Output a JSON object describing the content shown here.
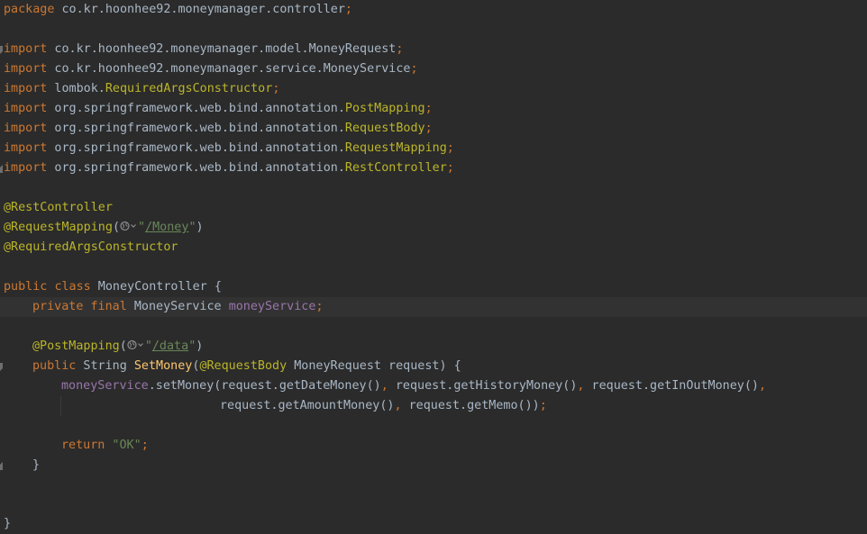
{
  "editor": {
    "lines": {
      "l1": {
        "kw": "package",
        "rest": " co.kr.hoonhee92.moneymanager.controller",
        "semi": ";"
      },
      "l3": {
        "kw": "import",
        "rest": " co.kr.hoonhee92.moneymanager.model.MoneyRequest",
        "semi": ";"
      },
      "l4": {
        "kw": "import",
        "rest": " co.kr.hoonhee92.moneymanager.service.MoneyService",
        "semi": ";"
      },
      "l5": {
        "kw": "import",
        "pkg": " lombok.",
        "cls": "RequiredArgsConstructor",
        "semi": ";"
      },
      "l6": {
        "kw": "import",
        "pkg": " org.springframework.web.bind.annotation.",
        "cls": "PostMapping",
        "semi": ";"
      },
      "l7": {
        "kw": "import",
        "pkg": " org.springframework.web.bind.annotation.",
        "cls": "RequestBody",
        "semi": ";"
      },
      "l8": {
        "kw": "import",
        "pkg": " org.springframework.web.bind.annotation.",
        "cls": "RequestMapping",
        "semi": ";"
      },
      "l9": {
        "kw": "import",
        "pkg": " org.springframework.web.bind.annotation.",
        "cls": "RestController",
        "semi": ";"
      },
      "l11": {
        "ann": "@RestController"
      },
      "l12": {
        "ann": "@RequestMapping",
        "open": "(",
        "q1": "\"",
        "url": "/Money",
        "q2": "\"",
        "close": ")"
      },
      "l13": {
        "ann": "@RequiredArgsConstructor"
      },
      "l15": {
        "kw1": "public",
        "kw2": "class",
        "name": " MoneyController ",
        "brace": "{"
      },
      "l16": {
        "kw1": "private",
        "kw2": "final",
        "type": " MoneyService ",
        "field": "moneyService",
        "semi": ";"
      },
      "l18": {
        "ann": "@PostMapping",
        "open": "(",
        "q1": "\"",
        "url": "/data",
        "q2": "\"",
        "close": ")"
      },
      "l19": {
        "kw": "public",
        "type": " String ",
        "fn": "SetMoney",
        "open": "(",
        "ann": "@RequestBody",
        "params": " MoneyRequest request) {"
      },
      "l20": {
        "field": "moneyService",
        "call": ".setMoney(request.getDateMoney()",
        "c1": ",",
        "p2": " request.getHistoryMoney()",
        "c2": ",",
        "p3": " request.getInOutMoney()",
        "c3": ","
      },
      "l21": {
        "p1": "request.getAmountMoney()",
        "c1": ",",
        "p2": " request.getMemo())",
        "semi": ";"
      },
      "l23": {
        "kw": "return",
        "str": " \"OK\"",
        "semi": ";"
      },
      "l24": {
        "brace": "}"
      },
      "l27": {
        "brace": "}"
      }
    }
  }
}
